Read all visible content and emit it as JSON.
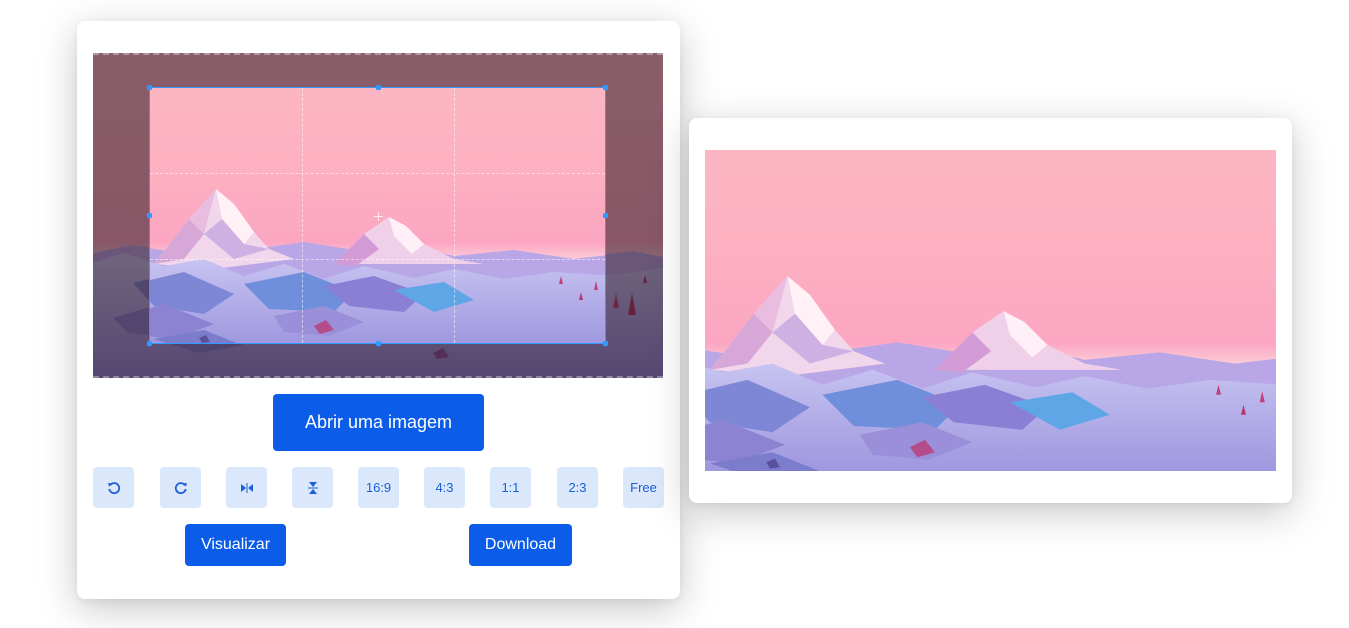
{
  "editor": {
    "open_image_label": "Abrir uma imagem",
    "preview_label": "Visualizar",
    "download_label": "Download",
    "tools": [
      {
        "icon": "rotate-left-icon",
        "label": ""
      },
      {
        "icon": "rotate-right-icon",
        "label": ""
      },
      {
        "icon": "flip-horizontal-icon",
        "label": ""
      },
      {
        "icon": "flip-vertical-icon",
        "label": ""
      },
      {
        "icon": "",
        "label": "16:9"
      },
      {
        "icon": "",
        "label": "4:3"
      },
      {
        "icon": "",
        "label": "1:1"
      },
      {
        "icon": "",
        "label": "2:3"
      },
      {
        "icon": "",
        "label": "Free"
      }
    ]
  },
  "image": {
    "description_icon": "low-poly-mountain-landscape-image"
  },
  "colors": {
    "primary": "#0b5ce8",
    "tool_bg": "#dbe8fb",
    "tool_fg": "#1a5fd8",
    "crop_border": "#3399ff"
  }
}
